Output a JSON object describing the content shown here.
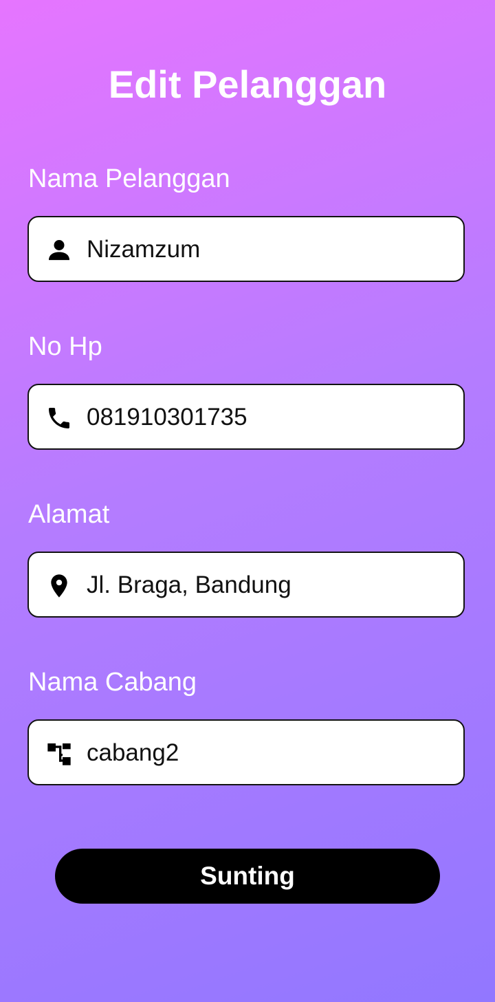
{
  "page": {
    "title": "Edit Pelanggan",
    "background_colors": [
      "#e675ff",
      "#b57cff",
      "#9277ff"
    ]
  },
  "fields": [
    {
      "label": "Nama Pelanggan",
      "value": "Nizamzum",
      "icon": "person-icon"
    },
    {
      "label": "No Hp",
      "value": "081910301735",
      "icon": "phone-icon"
    },
    {
      "label": "Alamat",
      "value": "Jl. Braga, Bandung",
      "icon": "location-pin-icon"
    },
    {
      "label": "Nama Cabang",
      "value": "cabang2",
      "icon": "branch-tree-icon"
    }
  ],
  "submit": {
    "label": "Sunting",
    "color": "#000000"
  }
}
